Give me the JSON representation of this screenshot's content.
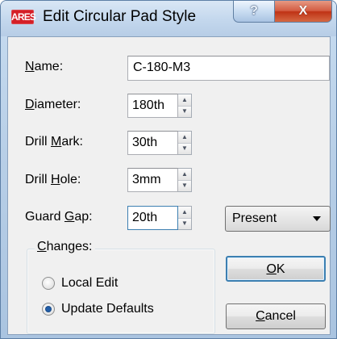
{
  "window": {
    "title": "Edit Circular Pad Style",
    "app_icon_text": "ARES",
    "help_button": "?",
    "close_button": "X"
  },
  "form": {
    "name_label": "Name:",
    "name_value": "C-180-M3",
    "diameter_label": "Diameter:",
    "diameter_value": "180th",
    "drill_mark_label": "Drill Mark:",
    "drill_mark_value": "30th",
    "drill_hole_label": "Drill Hole:",
    "drill_hole_value": "3mm",
    "guard_gap_label": "Guard Gap:",
    "guard_gap_value": "20th",
    "guard_gap_mode": "Present"
  },
  "changes": {
    "group_label": "Changes:",
    "local_edit_label": "Local Edit",
    "update_defaults_label": "Update Defaults",
    "selected": "Update Defaults"
  },
  "buttons": {
    "ok_label": "OK",
    "cancel_label": "Cancel"
  },
  "icons": {
    "app": "ares-icon",
    "help": "help-icon",
    "close": "close-icon",
    "spin_up": "chevron-up-icon",
    "spin_down": "chevron-down-icon",
    "dropdown": "dropdown-arrow-icon"
  },
  "colors": {
    "title_bar": "#c3d7ed",
    "dialog_background": "#f0f0f0",
    "close_button": "#c9482b",
    "default_button_border": "#3c7fb1",
    "radio_selected": "#225ea8"
  }
}
